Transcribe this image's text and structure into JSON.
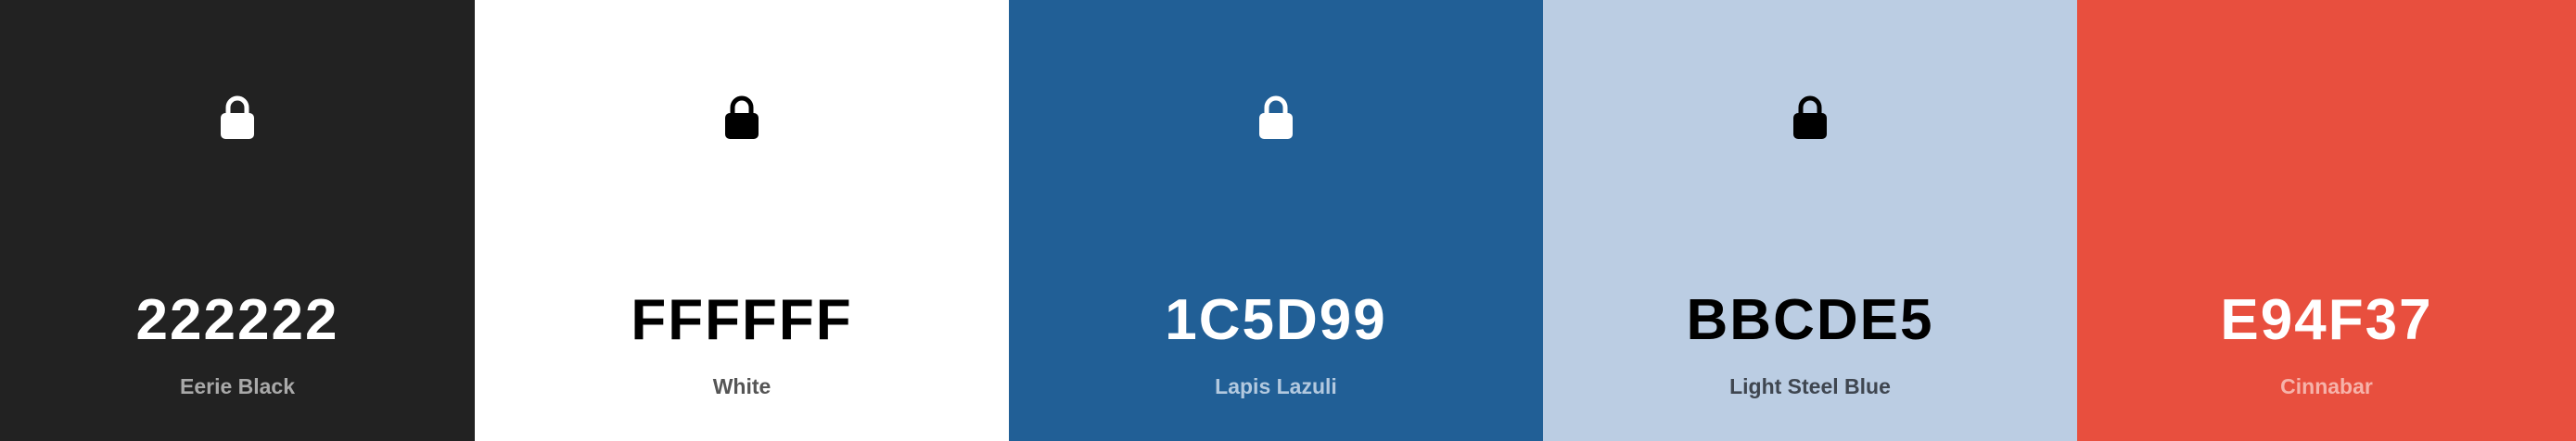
{
  "palette": {
    "colors": [
      {
        "hex": "222222",
        "name": "Eerie Black",
        "background": "#222222",
        "text_color": "#ffffff",
        "name_color": "#a9a9a9",
        "lock_color": "#ffffff",
        "lock_icon": "lock-icon"
      },
      {
        "hex": "FFFFFF",
        "name": "White",
        "background": "#ffffff",
        "text_color": "#000000",
        "name_color": "#555555",
        "lock_color": "#000000",
        "lock_icon": "lock-icon"
      },
      {
        "hex": "1C5D99",
        "name": "Lapis Lazuli",
        "background": "#215f96",
        "text_color": "#ffffff",
        "name_color": "#b3c9df",
        "lock_color": "#ffffff",
        "lock_icon": "lock-icon"
      },
      {
        "hex": "BBCDE5",
        "name": "Light Steel Blue",
        "background": "#bbcde3",
        "text_color": "#000000",
        "name_color": "#3f4650",
        "lock_color": "#000000",
        "lock_icon": "lock-icon"
      },
      {
        "hex": "E94F37",
        "name": "Cinnabar",
        "background": "#e84f3e",
        "text_color": "#ffffff",
        "name_color": "#f6b3aa",
        "lock_color": "#ffffff",
        "lock_icon": "lock-icon"
      }
    ]
  }
}
